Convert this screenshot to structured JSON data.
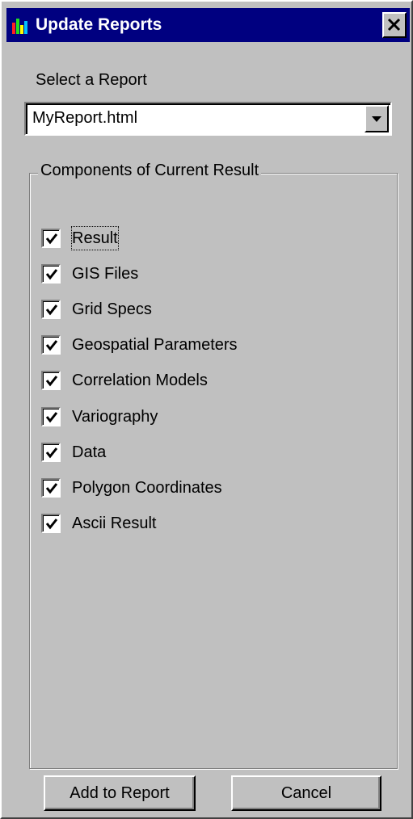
{
  "window": {
    "title": "Update Reports",
    "titlebar_color": "#000080",
    "close_label": "×"
  },
  "select_label": "Select a Report",
  "report_combo": {
    "value": "MyReport.html",
    "arrow_icon": "chevron-down-icon"
  },
  "components": {
    "legend": "Components of Current Result",
    "items": [
      {
        "label": "Result",
        "checked": true
      },
      {
        "label": "GIS Files",
        "checked": true
      },
      {
        "label": "Grid Specs",
        "checked": true
      },
      {
        "label": "Geospatial Parameters",
        "checked": true
      },
      {
        "label": "Correlation Models",
        "checked": true
      },
      {
        "label": "Variography",
        "checked": true
      },
      {
        "label": "Data",
        "checked": true
      },
      {
        "label": "Polygon Coordinates",
        "checked": true
      },
      {
        "label": "Ascii Result",
        "checked": true
      }
    ]
  },
  "buttons": {
    "add_label": "Add to Report",
    "cancel_label": "Cancel"
  }
}
